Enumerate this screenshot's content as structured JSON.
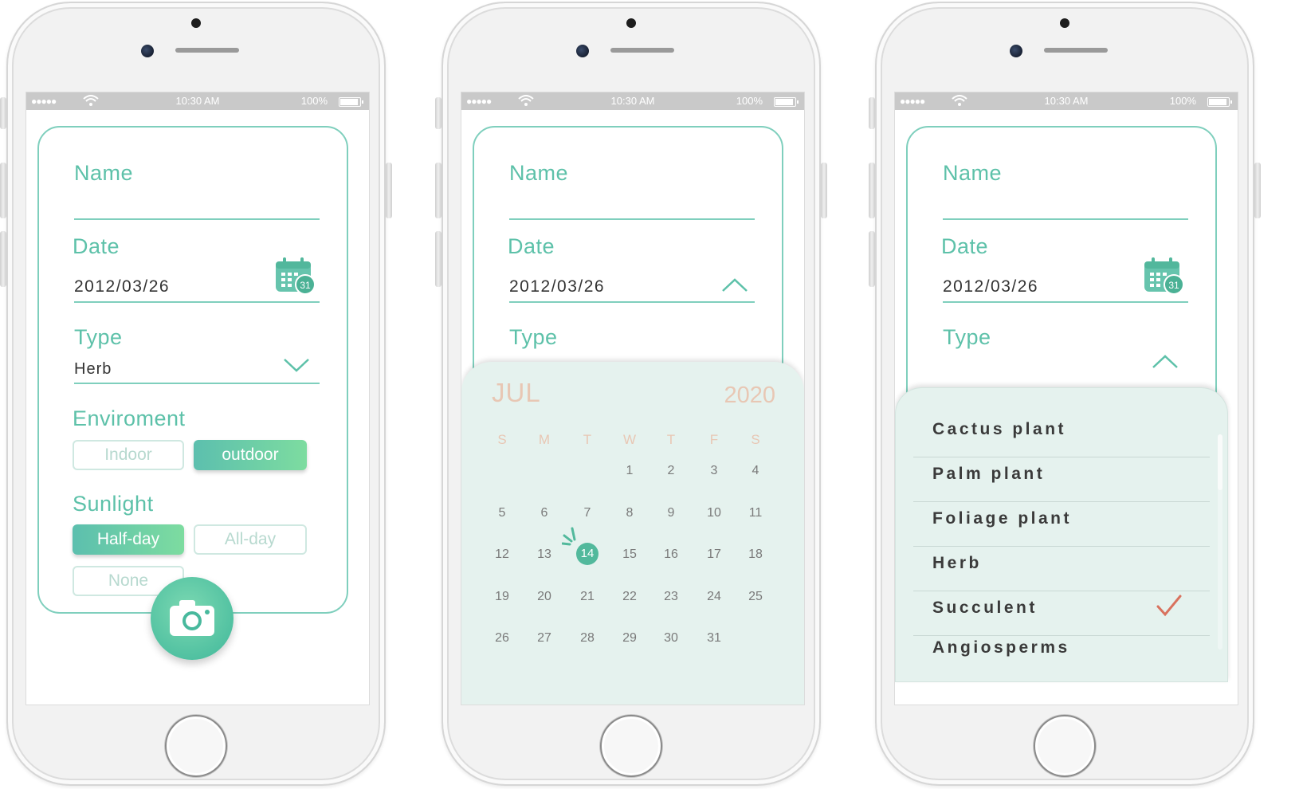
{
  "status": {
    "signal": "●●●●●",
    "time": "10:30 AM",
    "battery": "100%"
  },
  "screens": [
    {
      "name_label": "Name",
      "date_label": "Date",
      "date_value": "2012/03/26",
      "calendar_badge": "31",
      "type_label": "Type",
      "type_value": "Herb",
      "environment_label": "Enviroment",
      "env_indoor": "Indoor",
      "env_outdoor": "outdoor",
      "sunlight_label": "Sunlight",
      "sun_halfday": "Half-day",
      "sun_allday": "All-day",
      "sun_none": "None"
    },
    {
      "name_label": "Name",
      "date_label": "Date",
      "date_value": "2012/03/26",
      "type_label": "Type",
      "calendar": {
        "month": "JUL",
        "year": "2020",
        "weekdays": [
          "S",
          "M",
          "T",
          "W",
          "T",
          "F",
          "S"
        ],
        "days": [
          "1",
          "2",
          "3",
          "4",
          "5",
          "6",
          "7",
          "8",
          "9",
          "10",
          "11",
          "12",
          "13",
          "14",
          "15",
          "16",
          "17",
          "18",
          "19",
          "20",
          "21",
          "22",
          "23",
          "24",
          "25",
          "26",
          "27",
          "28",
          "29",
          "30",
          "31"
        ],
        "selected": "14"
      }
    },
    {
      "name_label": "Name",
      "date_label": "Date",
      "date_value": "2012/03/26",
      "calendar_badge": "31",
      "type_label": "Type",
      "options": [
        "Cactus plant",
        "Palm plant",
        "Foliage plant",
        "Herb",
        "Succulent",
        "Angiosperms"
      ],
      "checked_option": "Succulent"
    }
  ],
  "icons": {
    "calendar": "calendar-icon",
    "chevron_down": "chevron-down-icon",
    "chevron_up": "chevron-up-icon",
    "camera": "camera-icon",
    "check": "checkmark-icon",
    "wifi": "wifi-icon",
    "battery": "battery-icon"
  },
  "colors": {
    "accent": "#5dc1a9",
    "panel": "#e5f2ee",
    "calendar_text": "#e8c7b4",
    "check": "#d9725e"
  }
}
